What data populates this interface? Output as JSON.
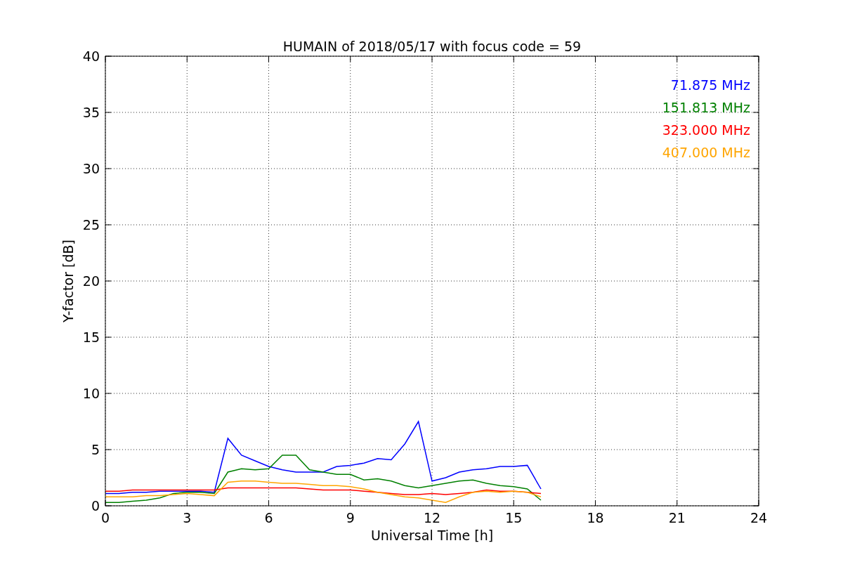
{
  "figure": {
    "chart_data": {
      "type": "line",
      "grid": true,
      "title": "HUMAIN of 2018/05/17 with focus code = 59",
      "xlabel": "Universal Time [h]",
      "ylabel": "Y-factor [dB]",
      "xlim": [
        0,
        24
      ],
      "ylim": [
        0,
        40
      ],
      "xticks": [
        0,
        3,
        6,
        9,
        12,
        15,
        18,
        21,
        24
      ],
      "yticks": [
        0,
        5,
        10,
        15,
        20,
        25,
        30,
        35,
        40
      ],
      "x": [
        0,
        0.5,
        1,
        1.5,
        2,
        2.5,
        3,
        3.5,
        4,
        4.5,
        5,
        5.5,
        6,
        6.5,
        7,
        7.5,
        8,
        8.5,
        9,
        9.5,
        10,
        10.5,
        11,
        11.5,
        12,
        12.5,
        13,
        13.5,
        14,
        14.5,
        15,
        15.5,
        16
      ],
      "series": [
        {
          "name": "71.875 MHz",
          "color": "#0000ff",
          "values": [
            1.1,
            1.1,
            1.2,
            1.2,
            1.3,
            1.3,
            1.3,
            1.3,
            1.2,
            6.0,
            4.5,
            4.0,
            3.5,
            3.2,
            3.0,
            3.0,
            3.0,
            3.5,
            3.6,
            3.8,
            4.2,
            4.1,
            5.5,
            7.5,
            2.2,
            2.5,
            3.0,
            3.2,
            3.3,
            3.5,
            3.5,
            3.6,
            1.5
          ]
        },
        {
          "name": "151.813 MHz",
          "color": "#008000",
          "values": [
            0.3,
            0.3,
            0.4,
            0.5,
            0.7,
            1.1,
            1.2,
            1.2,
            1.1,
            3.0,
            3.3,
            3.2,
            3.3,
            4.5,
            4.5,
            3.2,
            3.0,
            2.8,
            2.8,
            2.3,
            2.4,
            2.2,
            1.8,
            1.6,
            1.8,
            2.0,
            2.2,
            2.3,
            2.0,
            1.8,
            1.7,
            1.5,
            0.5
          ]
        },
        {
          "name": "323.000 MHz",
          "color": "#ff0000",
          "values": [
            1.3,
            1.3,
            1.4,
            1.4,
            1.4,
            1.4,
            1.4,
            1.4,
            1.4,
            1.6,
            1.6,
            1.6,
            1.6,
            1.6,
            1.6,
            1.5,
            1.4,
            1.4,
            1.4,
            1.3,
            1.2,
            1.1,
            1.0,
            1.0,
            1.1,
            1.0,
            1.1,
            1.2,
            1.4,
            1.3,
            1.3,
            1.2,
            1.1
          ]
        },
        {
          "name": "407.000 MHz",
          "color": "#ffa500",
          "values": [
            0.8,
            0.8,
            0.8,
            0.9,
            0.9,
            1.0,
            1.1,
            1.0,
            0.9,
            2.1,
            2.2,
            2.2,
            2.1,
            2.0,
            2.0,
            1.9,
            1.8,
            1.8,
            1.7,
            1.5,
            1.2,
            1.0,
            0.8,
            0.7,
            0.5,
            0.3,
            0.8,
            1.2,
            1.3,
            1.2,
            1.3,
            1.2,
            0.8
          ]
        }
      ]
    }
  }
}
